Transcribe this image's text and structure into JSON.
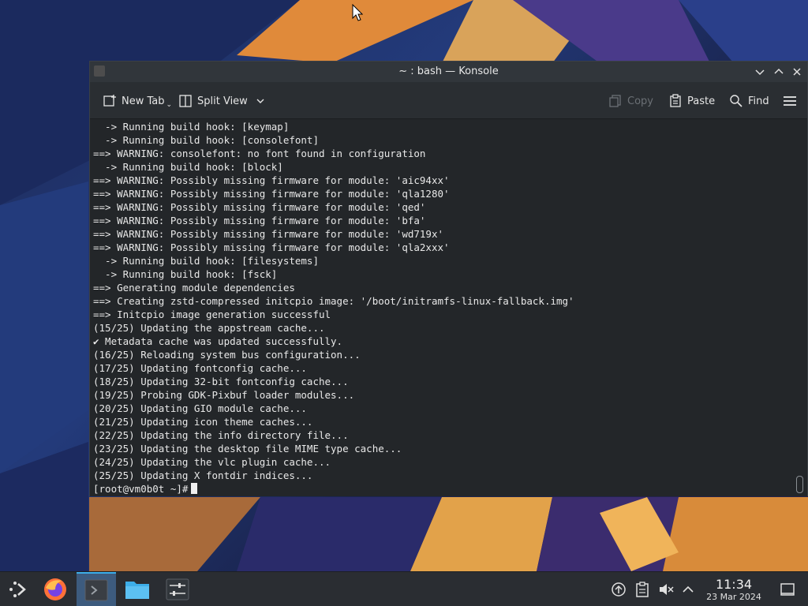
{
  "window": {
    "title": "~ : bash — Konsole",
    "minimize_glyph": "⌄",
    "maximize_glyph": "⌃",
    "close_glyph": "✕"
  },
  "toolbar": {
    "new_tab": "New Tab",
    "split_view": "Split View",
    "copy": "Copy",
    "paste": "Paste",
    "find": "Find"
  },
  "terminal": {
    "lines": [
      "  -> Running build hook: [keymap]",
      "  -> Running build hook: [consolefont]",
      "==> WARNING: consolefont: no font found in configuration",
      "  -> Running build hook: [block]",
      "==> WARNING: Possibly missing firmware for module: 'aic94xx'",
      "==> WARNING: Possibly missing firmware for module: 'qla1280'",
      "==> WARNING: Possibly missing firmware for module: 'qed'",
      "==> WARNING: Possibly missing firmware for module: 'bfa'",
      "==> WARNING: Possibly missing firmware for module: 'wd719x'",
      "==> WARNING: Possibly missing firmware for module: 'qla2xxx'",
      "  -> Running build hook: [filesystems]",
      "  -> Running build hook: [fsck]",
      "==> Generating module dependencies",
      "==> Creating zstd-compressed initcpio image: '/boot/initramfs-linux-fallback.img'",
      "==> Initcpio image generation successful",
      "(15/25) Updating the appstream cache...",
      "✔ Metadata cache was updated successfully.",
      "(16/25) Reloading system bus configuration...",
      "(17/25) Updating fontconfig cache...",
      "(18/25) Updating 32-bit fontconfig cache...",
      "(19/25) Probing GDK-Pixbuf loader modules...",
      "(20/25) Updating GIO module cache...",
      "(21/25) Updating icon theme caches...",
      "(22/25) Updating the info directory file...",
      "(23/25) Updating the desktop file MIME type cache...",
      "(24/25) Updating the vlc plugin cache...",
      "(25/25) Updating X fontdir indices..."
    ],
    "prompt": "[root@vm0b0t ~]#"
  },
  "taskbar": {
    "time": "11:34",
    "date": "23 Mar 2024"
  },
  "colors": {
    "accent": "#3daee9",
    "terminal_bg": "#232629",
    "toolbar_bg": "#2a2e32"
  }
}
